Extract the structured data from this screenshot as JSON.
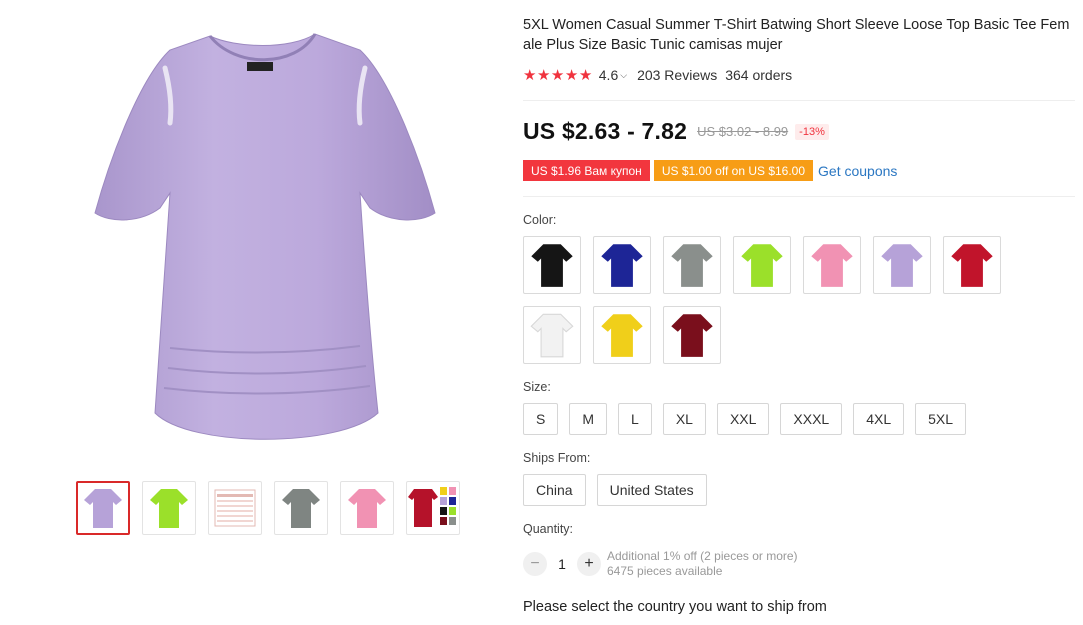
{
  "product": {
    "title": "5XL Women Casual Summer T-Shirt Batwing Short Sleeve Loose Top Basic Tee Female Plus Size Basic Tunic camisas mujer",
    "main_image_icon": "lavender-tshirt-image",
    "rating": "4.6",
    "stars_count": 5,
    "reviews": "203 Reviews",
    "orders": "364 orders"
  },
  "gallery": {
    "thumbnails": [
      {
        "name": "thumb-lavender",
        "color": "#b6a2d8"
      },
      {
        "name": "thumb-lime",
        "color": "#9be02a"
      },
      {
        "name": "thumb-size-chart",
        "color": "#e3b9b3"
      },
      {
        "name": "thumb-gray",
        "color": "#7f8582"
      },
      {
        "name": "thumb-pink",
        "color": "#f192b3"
      },
      {
        "name": "thumb-multicolor",
        "color": "#b5122a"
      }
    ]
  },
  "price": {
    "current": "US $2.63 - 7.82",
    "original": "US $3.02 - 8.99",
    "discount": "-13%"
  },
  "coupons": {
    "coupon1": "US $1.96 Вам купон",
    "coupon2": "US $1.00 off on US $16.00",
    "get_coupons": "Get coupons"
  },
  "color": {
    "label": "Color:",
    "swatches": [
      {
        "name": "black",
        "hex": "#151515"
      },
      {
        "name": "navy",
        "hex": "#1d2596"
      },
      {
        "name": "gray",
        "hex": "#8a8f8c"
      },
      {
        "name": "lime",
        "hex": "#9be02a"
      },
      {
        "name": "pink",
        "hex": "#f192b3"
      },
      {
        "name": "lavender",
        "hex": "#b6a2d8"
      },
      {
        "name": "red",
        "hex": "#c1142b"
      },
      {
        "name": "white",
        "hex": "#f2f2f2"
      },
      {
        "name": "yellow",
        "hex": "#f0cf1a"
      },
      {
        "name": "burgundy",
        "hex": "#7a0f1c"
      }
    ]
  },
  "size": {
    "label": "Size:",
    "options": [
      "S",
      "M",
      "L",
      "XL",
      "XXL",
      "XXXL",
      "4XL",
      "5XL"
    ]
  },
  "ships_from": {
    "label": "Ships From:",
    "options": [
      "China",
      "United States"
    ]
  },
  "quantity": {
    "label": "Quantity:",
    "value": "1",
    "minus": "−",
    "plus": "+",
    "discount_note": "Additional 1% off (2 pieces or more)",
    "available": "6475 pieces available"
  },
  "ship_note": "Please select the country you want to ship from"
}
